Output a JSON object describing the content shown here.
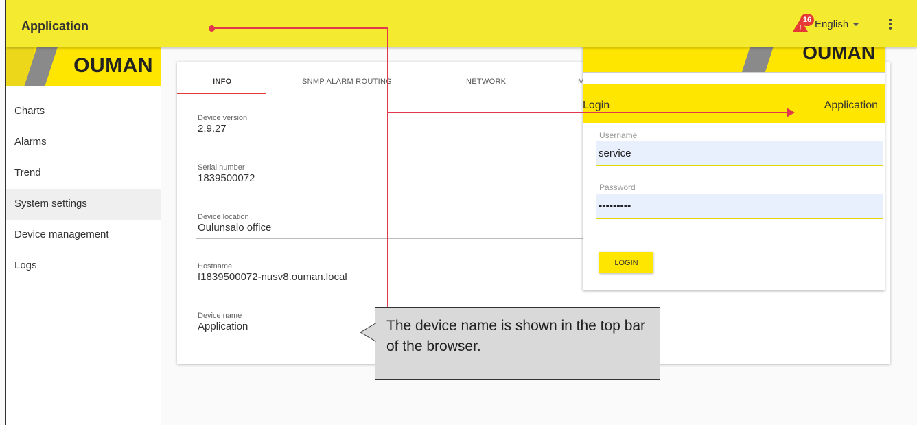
{
  "topbar": {
    "title": "Application",
    "notification_count": "16",
    "notification_icon": "alert-triangle-icon",
    "language": "English"
  },
  "sidebar": {
    "logo": "OUMAN",
    "items": [
      {
        "label": "Charts"
      },
      {
        "label": "Alarms"
      },
      {
        "label": "Trend"
      },
      {
        "label": "System settings",
        "active": true
      },
      {
        "label": "Device management"
      },
      {
        "label": "Logs"
      }
    ]
  },
  "tabs": [
    {
      "label": "INFO",
      "active": true
    },
    {
      "label": "SNMP ALARM ROUTING"
    },
    {
      "label": "NETWORK"
    },
    {
      "label": "M"
    }
  ],
  "info": {
    "device_version_label": "Device version",
    "device_version": "2.9.27",
    "serial_number_label": "Serial number",
    "serial_number": "1839500072",
    "device_location_label": "Device location",
    "device_location": "Oulunsalo office",
    "hostname_label": "Hostname",
    "hostname": "f1839500072-nusv8.ouman.local",
    "device_name_label": "Device name",
    "device_name": "Application"
  },
  "login": {
    "logo": "OUMAN",
    "title": "Login",
    "app_name": "Application",
    "username_label": "Username",
    "username_value": "service",
    "password_label": "Password",
    "password_value": "•••••••••",
    "login_button": "LOGIN"
  },
  "callout": {
    "text": "The device name is shown in the top bar of the browser."
  },
  "colors": {
    "topbar": "#f4ea2f",
    "brand_yellow": "#ffe600",
    "accent_red": "#e53935",
    "annotation_red": "#e2384d"
  }
}
